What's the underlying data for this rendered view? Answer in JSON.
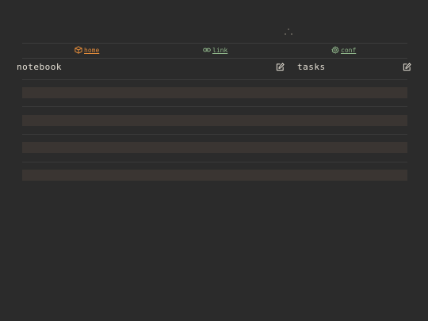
{
  "loader": {
    "icon": "loading-dots-icon"
  },
  "nav": {
    "items": [
      {
        "label": "home",
        "icon": "cube-icon",
        "color": "#e08a3a"
      },
      {
        "label": "link",
        "icon": "link-icon",
        "color": "#8fb58a"
      },
      {
        "label": "conf",
        "icon": "gear-icon",
        "color": "#8fb58a"
      }
    ]
  },
  "panels": {
    "notebook": {
      "title": "notebook",
      "action_icon": "edit-icon"
    },
    "tasks": {
      "title": "tasks",
      "action_icon": "edit-icon"
    }
  },
  "list": {
    "rows": [
      {
        "text": ""
      },
      {
        "text": ""
      },
      {
        "text": ""
      },
      {
        "text": ""
      }
    ]
  },
  "colors": {
    "background": "#2b2b2b",
    "accent": "#e08a3a",
    "link": "#8fb58a",
    "text": "#e6e1d6",
    "row_placeholder": "#3a3532"
  }
}
